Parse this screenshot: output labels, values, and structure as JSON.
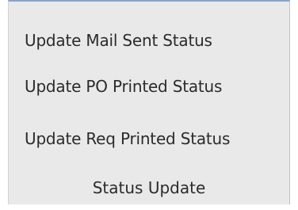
{
  "status_update_group": {
    "commands": [
      {
        "label": "Update Mail Sent Status"
      },
      {
        "label": "Update PO Printed Status"
      },
      {
        "label": "Update Req Printed Status"
      }
    ],
    "group_label": "Status Update"
  }
}
